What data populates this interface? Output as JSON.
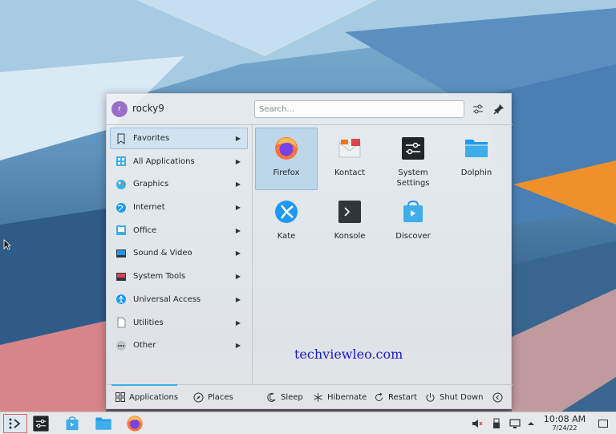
{
  "user": {
    "initial": "r",
    "name": "rocky9"
  },
  "search": {
    "placeholder": "Search..."
  },
  "header_icons": [
    "configure-icon",
    "pin-icon"
  ],
  "categories": [
    {
      "label": "Favorites",
      "icon": "bookmark-icon",
      "active": true
    },
    {
      "label": "All Applications",
      "icon": "grid-icon"
    },
    {
      "label": "Graphics",
      "icon": "graphics-icon"
    },
    {
      "label": "Internet",
      "icon": "globe-icon"
    },
    {
      "label": "Office",
      "icon": "office-icon"
    },
    {
      "label": "Sound & Video",
      "icon": "multimedia-icon"
    },
    {
      "label": "System Tools",
      "icon": "system-icon"
    },
    {
      "label": "Universal Access",
      "icon": "accessibility-icon"
    },
    {
      "label": "Utilities",
      "icon": "utilities-icon"
    },
    {
      "label": "Other",
      "icon": "other-icon"
    }
  ],
  "apps": [
    {
      "label": "Firefox",
      "icon": "firefox-icon",
      "active": true
    },
    {
      "label": "Kontact",
      "icon": "kontact-icon"
    },
    {
      "label": "System\nSettings",
      "icon": "system-settings-icon"
    },
    {
      "label": "Dolphin",
      "icon": "dolphin-folder-icon"
    },
    {
      "label": "Kate",
      "icon": "kate-icon"
    },
    {
      "label": "Konsole",
      "icon": "konsole-icon"
    },
    {
      "label": "Discover",
      "icon": "discover-icon"
    }
  ],
  "footer": {
    "applications": "Applications",
    "places": "Places",
    "sleep": "Sleep",
    "hibernate": "Hibernate",
    "restart": "Restart",
    "shutdown": "Shut Down"
  },
  "watermark": "techviewleo.com",
  "taskbar": {
    "items": [
      "application-launcher-icon",
      "system-settings-icon",
      "discover-icon",
      "dolphin-icon",
      "firefox-icon"
    ],
    "tray": [
      "muted-volume-icon",
      "usb-icon",
      "display-icon",
      "tray-expand-icon"
    ],
    "time": "10:08 AM",
    "date": "7/24/22"
  },
  "colors": {
    "accent": "#3daee9",
    "selection": "#bcd7ea",
    "panel": "#e6e8ea"
  }
}
